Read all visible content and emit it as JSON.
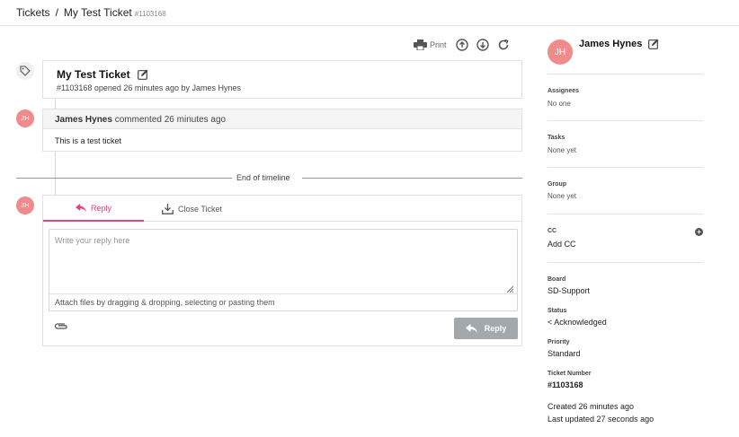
{
  "breadcrumb": {
    "root": "Tickets",
    "separator": "/",
    "current": "My Test Ticket",
    "ticket_id": "#1103168"
  },
  "toolbar": {
    "print_label": "Print",
    "icons": [
      "print-icon",
      "scroll-up-icon",
      "scroll-down-icon",
      "refresh-icon"
    ]
  },
  "ticket": {
    "title": "My Test Ticket",
    "subtitle": "#1103168 opened 26 minutes ago by James Hynes"
  },
  "comment": {
    "avatar_initials": "JH",
    "author": "James Hynes",
    "action": " commented 26 minutes ago",
    "body": "This is a test ticket"
  },
  "timeline": {
    "end_label": "End of timeline"
  },
  "reply": {
    "avatar_initials": "JH",
    "tabs": [
      {
        "label": "Reply",
        "active": true
      },
      {
        "label": "Close Ticket",
        "active": false
      }
    ],
    "placeholder": "Write your reply here",
    "attach_hint": "Attach files by dragging & dropping, selecting or pasting them",
    "submit_label": "Reply"
  },
  "sidebar": {
    "avatar_initials": "JH",
    "name": "James Hynes",
    "assignees": {
      "label": "Assignees",
      "value": "No one"
    },
    "tasks": {
      "label": "Tasks",
      "value": "None yet"
    },
    "group": {
      "label": "Group",
      "value": "None yet"
    },
    "cc": {
      "label": "CC",
      "value": "Add CC"
    },
    "board": {
      "label": "Board",
      "value": "SD-Support"
    },
    "status": {
      "label": "Status",
      "value": "< Acknowledged"
    },
    "priority": {
      "label": "Priority",
      "value": "Standard"
    },
    "ticket_number": {
      "label": "Ticket Number",
      "value": "#1103168"
    },
    "created": "Created 26 minutes ago",
    "updated": "Last updated 27 seconds ago"
  },
  "colors": {
    "accent": "#e0467a",
    "avatar": "#f08b8b",
    "reply_button": "#a3a8ad"
  }
}
